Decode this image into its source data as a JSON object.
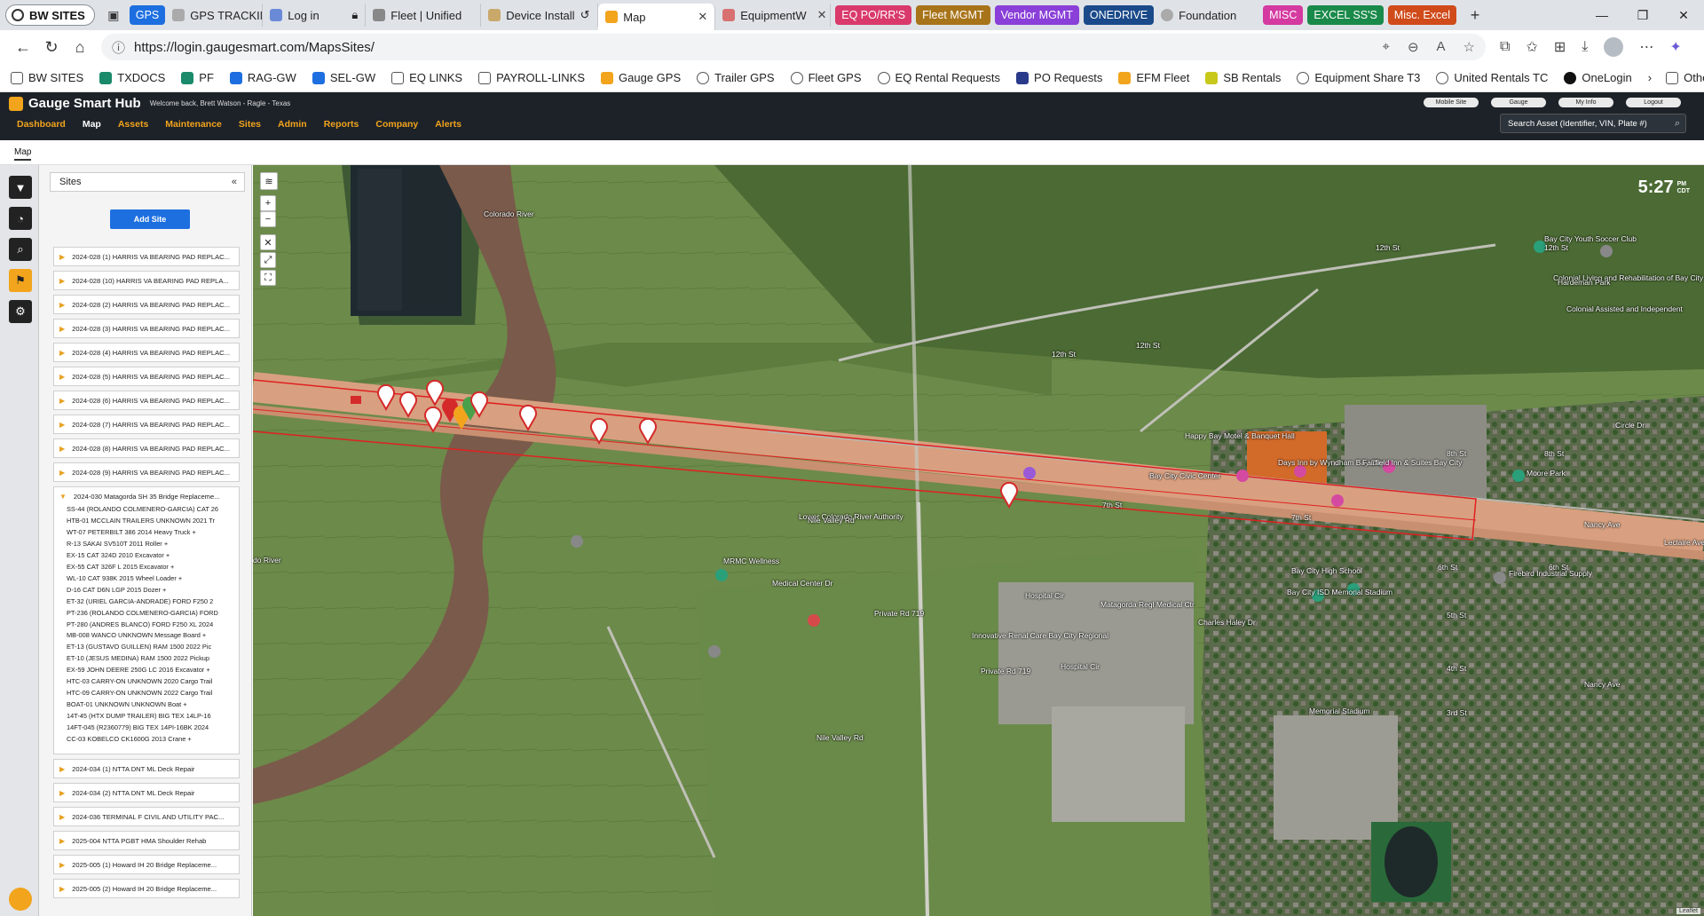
{
  "browser": {
    "profile": "BW SITES",
    "tabs": [
      {
        "label": "GPS",
        "color": "#1d6fe0",
        "type": "pill"
      },
      {
        "label": "GPS TRACKIN"
      },
      {
        "label": "Log in"
      },
      {
        "label": "Fleet | Unified"
      },
      {
        "label": "Device Install"
      },
      {
        "label": "Map",
        "active": true
      },
      {
        "label": "EquipmentW"
      }
    ],
    "group_pills": [
      {
        "label": "EQ PO/RR'S",
        "color": "#d93a6b"
      },
      {
        "label": "Fleet MGMT",
        "color": "#a8741a"
      },
      {
        "label": "Vendor MGMT",
        "color": "#8a3fd8"
      },
      {
        "label": "ONEDRIVE",
        "color": "#1a4a8a"
      },
      {
        "label": "Foundation",
        "color": "",
        "plain": true
      },
      {
        "label": "MISC",
        "color": "#d43aa0"
      },
      {
        "label": "EXCEL SS'S",
        "color": "#1a8a4a"
      },
      {
        "label": "Misc. Excel",
        "color": "#d04a1a"
      }
    ],
    "url": "https://login.gaugesmart.com/MapsSites/",
    "favorites": [
      "BW SITES",
      "TXDOCS",
      "PF",
      "RAG-GW",
      "SEL-GW",
      "EQ LINKS",
      "PAYROLL-LINKS",
      "Gauge GPS",
      "Trailer GPS",
      "Fleet GPS",
      "EQ Rental Requests",
      "PO Requests",
      "EFM Fleet",
      "SB Rentals",
      "Equipment Share T3",
      "United Rentals TC",
      "OneLogin"
    ],
    "other_favorites": "Other favorites"
  },
  "app": {
    "brand": "Gauge Smart Hub",
    "welcome": "Welcome back, Brett Watson - Ragle - Texas",
    "nav": [
      "Dashboard",
      "Map",
      "Assets",
      "Maintenance",
      "Sites",
      "Admin",
      "Reports",
      "Company",
      "Alerts"
    ],
    "top_pills": [
      "Mobile Site",
      "Gauge",
      "My Info",
      "Logout"
    ],
    "search_placeholder": "Search Asset (Identifier, VIN, Plate #)",
    "breadcrumb": "Map"
  },
  "panel": {
    "title": "Sites",
    "add_button": "Add Site",
    "sites": [
      "2024-028 (1) HARRIS VA BEARING PAD REPLAC...",
      "2024-028 (10) HARRIS VA BEARING PAD REPLA...",
      "2024-028 (2) HARRIS VA BEARING PAD REPLAC...",
      "2024-028 (3) HARRIS VA BEARING PAD REPLAC...",
      "2024-028 (4) HARRIS VA BEARING PAD REPLAC...",
      "2024-028 (5) HARRIS VA BEARING PAD REPLAC...",
      "2024-028 (6) HARRIS VA BEARING PAD REPLAC...",
      "2024-028 (7) HARRIS VA BEARING PAD REPLAC...",
      "2024-028 (8) HARRIS VA BEARING PAD REPLAC...",
      "2024-028 (9) HARRIS VA BEARING PAD REPLAC..."
    ],
    "open_site": {
      "label": "2024-030 Matagorda SH 35 Bridge Replaceme...",
      "assets": [
        "SS-44 (ROLANDO COLMENERO-GARCIA) CAT 26",
        "HTB-01 MCCLAIN TRAILERS UNKNOWN 2021 Tr",
        "WT-07 PETERBILT 386 2014 Heavy Truck +",
        "R-13 SAKAI SV510T 2011 Roller +",
        "EX-15 CAT 324D 2010 Excavator +",
        "EX-55 CAT 326F L 2015 Excavator +",
        "WL-10 CAT 938K 2015 Wheel Loader +",
        "D-16 CAT D6N LGP 2015 Dozer +",
        "ET-32 (URIEL GARCIA-ANDRADE) FORD F250 2",
        "PT-236 (ROLANDO COLMENERO-GARCIA) FORD",
        "PT-280 (ANDRES BLANCO) FORD F250 XL 2024",
        "MB-008 WANCO UNKNOWN Message Board +",
        "ET-13 (GUSTAVO GUILLEN) RAM 1500 2022 Pic",
        "ET-10 (JESUS MEDINA) RAM 1500 2022 Pickup",
        "EX-59 JOHN DEERE 250G LC 2016 Excavator +",
        "HTC-03 CARRY-ON UNKNOWN 2020 Cargo Trail",
        "HTC-09 CARRY-ON UNKNOWN 2022 Cargo Trail",
        "BOAT-01 UNKNOWN UNKNOWN Boat +",
        "14T-45 (HTX DUMP TRAILER) BIG TEX 14LP-16",
        "14FT-045 (R2360779) BIG TEX 14PI-16BK 2024",
        "CC-03 KOBELCO CK1600G 2013 Crane +"
      ]
    },
    "sites_after": [
      "2024-034 (1) NTTA DNT ML Deck Repair",
      "2024-034 (2) NTTA DNT ML Deck Repair",
      "2024-036 TERMINAL F CIVIL AND UTILITY PAC...",
      "2025-004 NTTA PGBT HMA Shoulder Rehab",
      "2025-005 (1) Howard IH 20 Bridge Replaceme...",
      "2025-005 (2) Howard IH 20 Bridge Replaceme..."
    ]
  },
  "map": {
    "time": "5:27",
    "ampm": "PM",
    "tz": "CDT",
    "labels": [
      {
        "text": "12th St"
      },
      {
        "text": "12th St"
      },
      {
        "text": "12th St"
      },
      {
        "text": "12th St"
      },
      {
        "text": "7th St"
      },
      {
        "text": "7th St"
      },
      {
        "text": "6th St"
      },
      {
        "text": "6th St"
      },
      {
        "text": "8th St"
      },
      {
        "text": "8th St"
      },
      {
        "text": "5th St"
      },
      {
        "text": "4th St"
      },
      {
        "text": "3rd St"
      },
      {
        "text": "Circle Dr"
      },
      {
        "text": "Bay City Civic Center"
      },
      {
        "text": "Days Inn by Wyndham Bay City"
      },
      {
        "text": "Fairfield Inn & Suites Bay City"
      },
      {
        "text": "Lower Colorado River Authority"
      },
      {
        "text": "Bay City High School"
      },
      {
        "text": "Bay City ISD Memorial Stadium"
      },
      {
        "text": "Matagorda Regl Medical Ctr"
      },
      {
        "text": "Innovative Renal Care Bay City Regional"
      },
      {
        "text": "MRMC Wellness"
      },
      {
        "text": "Medical Center Dr"
      },
      {
        "text": "Hospital Cir"
      },
      {
        "text": "Hospital Cir"
      },
      {
        "text": "Firebird Industrial Supply"
      },
      {
        "text": "Moore Park"
      },
      {
        "text": "Colonial Living and Rehabilitation of Bay City"
      },
      {
        "text": "Colonial Assisted and Independent"
      },
      {
        "text": "Bay City Youth Soccer Club"
      },
      {
        "text": "Hardeman Park"
      },
      {
        "text": "Memorial Stadium"
      },
      {
        "text": "Happy Bay Motel & Banquet Hall"
      },
      {
        "text": "Nile Valley Rd"
      },
      {
        "text": "Nile Valley Rd"
      },
      {
        "text": "Private Rd 719"
      },
      {
        "text": "Private Rd 719"
      },
      {
        "text": "Charles Haley Dr"
      },
      {
        "text": "Nancy Ave"
      },
      {
        "text": "Nancy Ave"
      },
      {
        "text": "Leclaire Ave"
      },
      {
        "text": "Colorado River"
      },
      {
        "text": "do River"
      }
    ],
    "attribution": "Leaflet"
  },
  "colors": {
    "accent": "#f2a41c",
    "header_bg": "#1d2229",
    "button_blue": "#1d6fe0",
    "marker_red": "#d42a2a",
    "geofence": "#e02020"
  }
}
